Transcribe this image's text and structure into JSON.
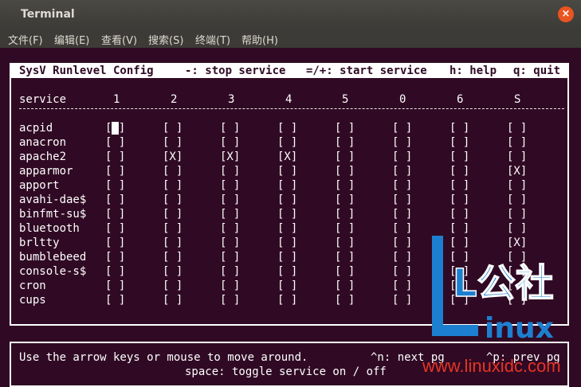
{
  "window": {
    "title": "Terminal",
    "close_glyph": "×"
  },
  "menu": [
    "文件(F)",
    "编辑(E)",
    "查看(V)",
    "搜索(S)",
    "终端(T)",
    "帮助(H)"
  ],
  "header": {
    "app_title": "SysV Runlevel Config",
    "stop": "-: stop service",
    "start": "=/+: start service",
    "help": "h: help",
    "quit": "q: quit"
  },
  "columns": {
    "label": "service",
    "runlevels": [
      "1",
      "2",
      "3",
      "4",
      "5",
      "0",
      "6",
      "S"
    ]
  },
  "divider": "------------------------------------------------------------------------------",
  "services": [
    {
      "name": "acpid",
      "states": [
        "[ ]",
        "[ ]",
        "[ ]",
        "[ ]",
        "[ ]",
        "[ ]",
        "[ ]",
        "[ ]"
      ]
    },
    {
      "name": "anacron",
      "states": [
        "[ ]",
        "[ ]",
        "[ ]",
        "[ ]",
        "[ ]",
        "[ ]",
        "[ ]",
        "[ ]"
      ]
    },
    {
      "name": "apache2",
      "states": [
        "[ ]",
        "[X]",
        "[X]",
        "[X]",
        "[ ]",
        "[ ]",
        "[ ]",
        "[ ]"
      ]
    },
    {
      "name": "apparmor",
      "states": [
        "[ ]",
        "[ ]",
        "[ ]",
        "[ ]",
        "[ ]",
        "[ ]",
        "[ ]",
        "[X]"
      ]
    },
    {
      "name": "apport",
      "states": [
        "[ ]",
        "[ ]",
        "[ ]",
        "[ ]",
        "[ ]",
        "[ ]",
        "[ ]",
        "[ ]"
      ]
    },
    {
      "name": "avahi-dae$",
      "states": [
        "[ ]",
        "[ ]",
        "[ ]",
        "[ ]",
        "[ ]",
        "[ ]",
        "[ ]",
        "[ ]"
      ]
    },
    {
      "name": "binfmt-su$",
      "states": [
        "[ ]",
        "[ ]",
        "[ ]",
        "[ ]",
        "[ ]",
        "[ ]",
        "[ ]",
        "[ ]"
      ]
    },
    {
      "name": "bluetooth",
      "states": [
        "[ ]",
        "[ ]",
        "[ ]",
        "[ ]",
        "[ ]",
        "[ ]",
        "[ ]",
        "[ ]"
      ]
    },
    {
      "name": "brltty",
      "states": [
        "[ ]",
        "[ ]",
        "[ ]",
        "[ ]",
        "[ ]",
        "[ ]",
        "[ ]",
        "[X]"
      ]
    },
    {
      "name": "bumblebeed",
      "states": [
        "[ ]",
        "[ ]",
        "[ ]",
        "[ ]",
        "[ ]",
        "[ ]",
        "[ ]",
        "[ ]"
      ]
    },
    {
      "name": "console-s$",
      "states": [
        "[ ]",
        "[ ]",
        "[ ]",
        "[ ]",
        "[ ]",
        "[ ]",
        "[ ]",
        "[ ]"
      ]
    },
    {
      "name": "cron",
      "states": [
        "[ ]",
        "[ ]",
        "[ ]",
        "[ ]",
        "[ ]",
        "[ ]",
        "[ ]",
        "[ ]"
      ]
    },
    {
      "name": "cups",
      "states": [
        "[ ]",
        "[ ]",
        "[ ]",
        "[ ]",
        "[ ]",
        "[ ]",
        "[ ]",
        "[ ]"
      ]
    }
  ],
  "footer": {
    "line1_left": "Use the arrow keys or mouse to move around.",
    "next": "^n: next pg",
    "prev": "^p: prev pg",
    "line2": "space: toggle service on / off"
  },
  "watermark": {
    "mark": "L公社",
    "brand": "inux",
    "url": "www.linuxidc.com"
  },
  "colors": {
    "background": "#300a24",
    "foreground": "#ffffff",
    "accent": "#e95420",
    "watermark_blue": "#1d7fd0",
    "watermark_red": "#e53424"
  }
}
